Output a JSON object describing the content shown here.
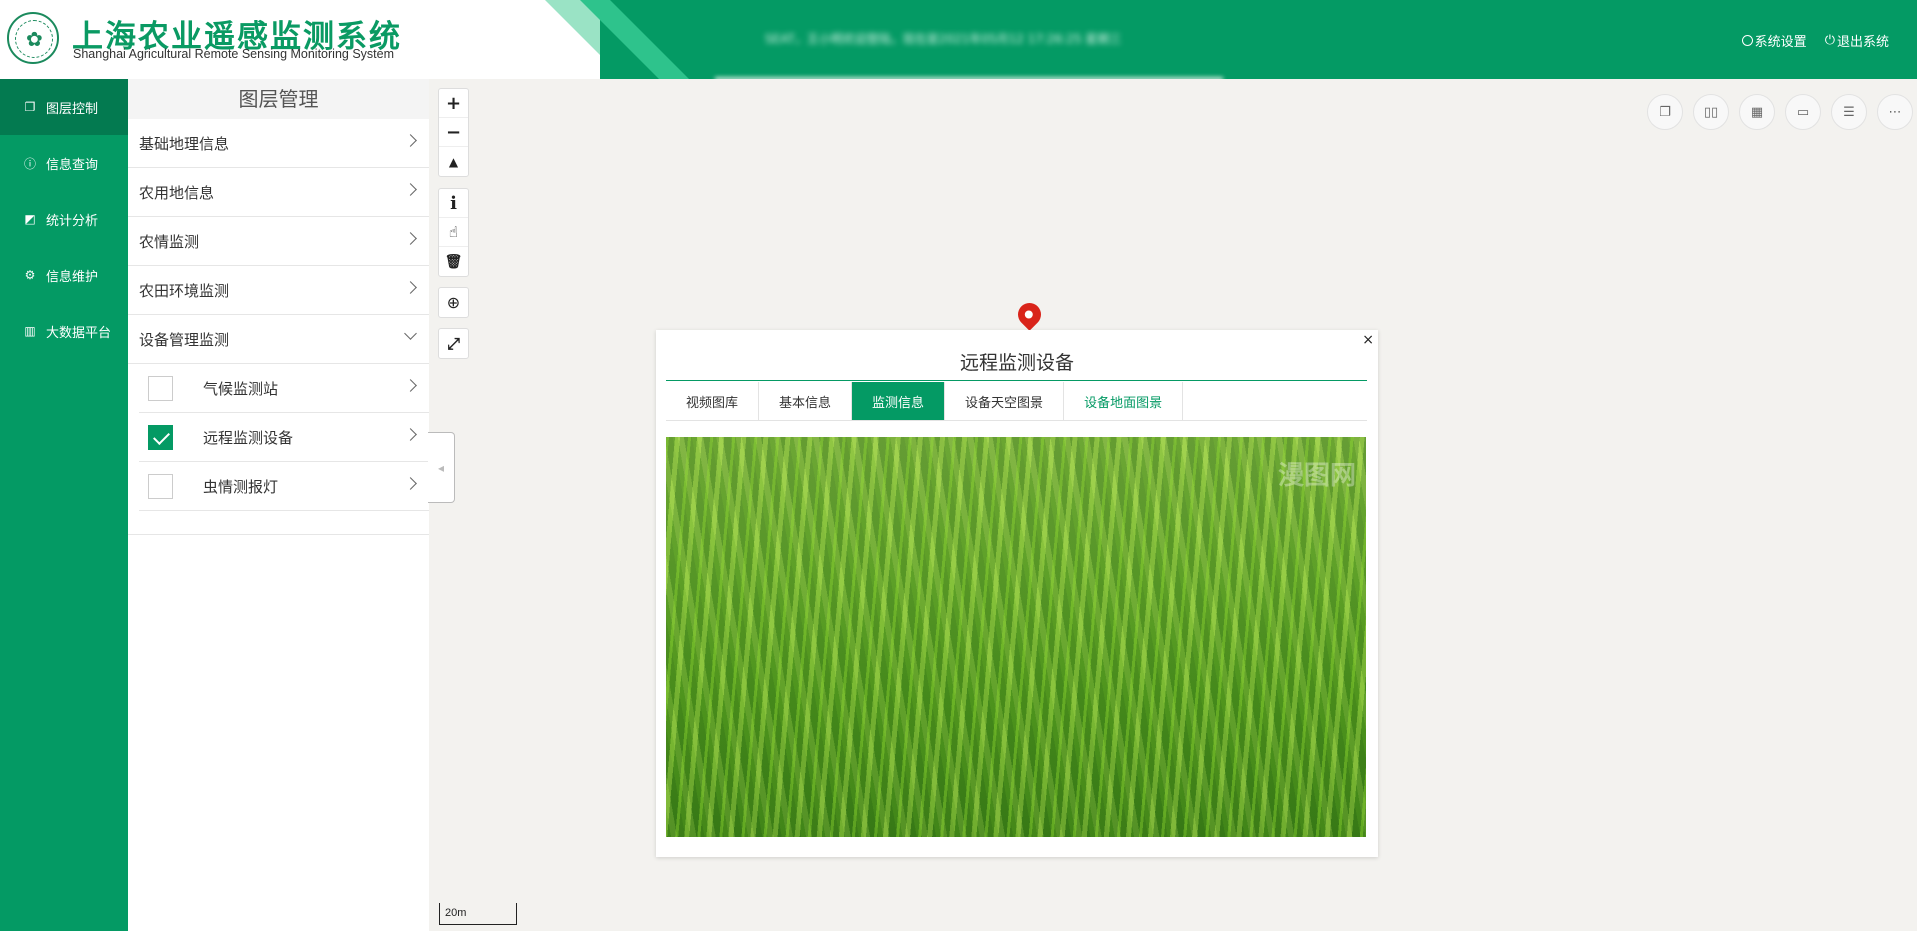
{
  "header": {
    "title_cn": "上海农业遥感监测系统",
    "title_en": "Shanghai Agricultural Remote Sensing Monitoring System",
    "marquee": "SEAT，王小明欢迎登陆，现在是2021年05月12 17:26:25 星期三",
    "settings_label": "系统设置",
    "logout_label": "退出系统"
  },
  "nav": {
    "items": [
      {
        "label": "图层控制",
        "icon": "layers-icon"
      },
      {
        "label": "信息查询",
        "icon": "info-icon"
      },
      {
        "label": "统计分析",
        "icon": "chart-icon"
      },
      {
        "label": "信息维护",
        "icon": "gear-icon"
      },
      {
        "label": "大数据平台",
        "icon": "bar-chart-icon"
      }
    ]
  },
  "panel": {
    "title": "图层管理",
    "groups": [
      "基础地理信息",
      "农用地信息",
      "农情监测",
      "农田环境监测",
      "设备管理监测"
    ],
    "sub_items": [
      {
        "label": "气候监测站",
        "checked": false
      },
      {
        "label": "远程监测设备",
        "checked": true
      },
      {
        "label": "虫情测报灯",
        "checked": false
      }
    ]
  },
  "popup": {
    "title": "远程监测设备",
    "close": "×",
    "tabs": [
      "视频图库",
      "基本信息",
      "监测信息",
      "设备天空图景",
      "设备地面图景"
    ],
    "active_tab": "监测信息",
    "watermark": "漫图网"
  },
  "map": {
    "scale_label": "20m"
  },
  "colors": {
    "brand": "#049a64",
    "pin": "#d9241a"
  }
}
